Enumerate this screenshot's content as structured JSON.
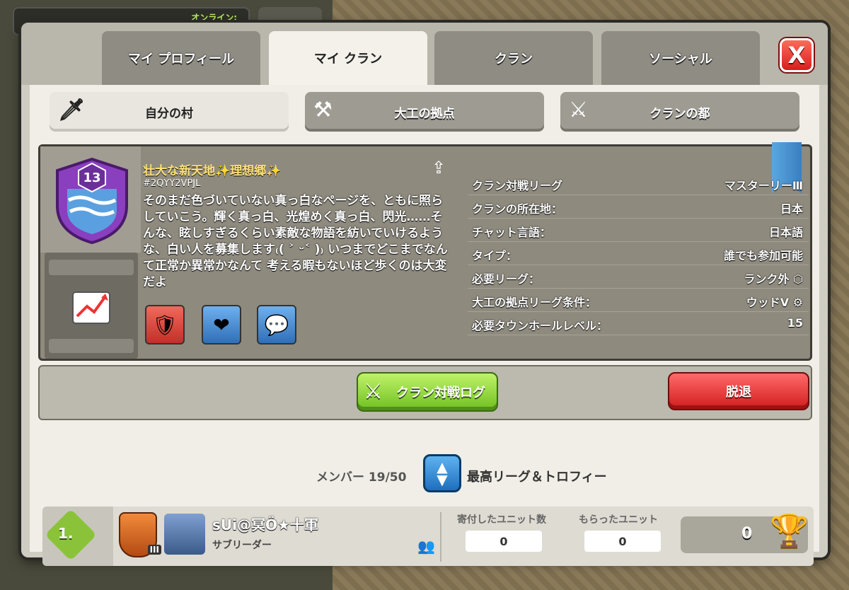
{
  "background": {
    "online_label": "オンライン:"
  },
  "tabs": [
    {
      "label": "マイ プロフィール"
    },
    {
      "label": "マイ クラン"
    },
    {
      "label": "クラン"
    },
    {
      "label": "ソーシャル"
    }
  ],
  "close_label": "X",
  "subtabs": [
    {
      "label": "自分の村",
      "icon": "sword-icon"
    },
    {
      "label": "大工の拠点",
      "icon": "axes-icon"
    },
    {
      "label": "クランの都",
      "icon": "crossed-swords-icon"
    }
  ],
  "clan": {
    "level": "13",
    "name": "壮大な新天地✨理想郷✨",
    "tag": "#2QYY2VPJL",
    "description": "そのまだ色づいていない真っ白なページを、ともに照らしていこう。輝く真っ白、光煌めく真っ白、閃光……そんな、眩しすぎるくらい素敵な物語を紡いでいけるような、白い人を募集します₍( ˃ ᵕ˂ )₎ いつまでどこまでなんて正常か異常かなんて 考える暇もないほど歩くのは大変だよ",
    "info": [
      {
        "key": "クラン対戦リーグ",
        "value": "マスターリーⅢ"
      },
      {
        "key": "クランの所在地：",
        "value": "日本"
      },
      {
        "key": "チャット言語：",
        "value": "日本語"
      },
      {
        "key": "タイプ：",
        "value": "誰でも参加可能"
      },
      {
        "key": "必要リーグ：",
        "value": "ランク外 ⬡"
      },
      {
        "key": "大工の拠点リーグ条件：",
        "value": "ウッドⅤ ⚙"
      },
      {
        "key": "必要タウンホールレベル：",
        "value": "15"
      }
    ]
  },
  "actions": {
    "war_log": "クラン対戦ログ",
    "leave": "脱退"
  },
  "members": {
    "label": "メンバー 19/50",
    "sort_label": "最高リーグ＆トロフィー"
  },
  "member_rows": [
    {
      "rank": "1.",
      "league_tier": "III",
      "name": "sUi@冥Ö★十軍",
      "role": "サブリーダー",
      "donated_label": "寄付したユニット数",
      "donated": "0",
      "received_label": "もらったユニット",
      "received": "0",
      "trophies": "0"
    }
  ],
  "colors": {
    "accent_green": "#6fbf1f",
    "danger_red": "#d11d1d",
    "clan_name_gold": "#ffe27a",
    "badge_purple": "#8a3fbf"
  }
}
